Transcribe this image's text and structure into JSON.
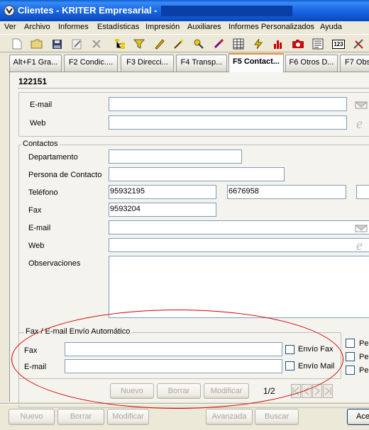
{
  "window": {
    "title": "Clientes - KRITER Empresarial -"
  },
  "menu": [
    "Ver",
    "Archivo",
    "Informes",
    "Estadísticas",
    "Impresión",
    "Auxiliares",
    "Informes Personalizados",
    "Ayuda"
  ],
  "toolbar_icons": [
    "new-icon",
    "open-icon",
    "save-icon",
    "edit-icon",
    "delete-icon",
    "tree-icon",
    "filter-icon",
    "pencil-icon",
    "wand-icon",
    "pin-icon",
    "brush-icon",
    "table-icon",
    "lightning-icon",
    "bar-chart-icon",
    "camera-icon",
    "form-icon",
    "numbers-icon",
    "tools-icon"
  ],
  "toolbar_numbers_label": "123",
  "tabs": [
    {
      "label": "Alt+F1 Gra..."
    },
    {
      "label": "F2 Condic...."
    },
    {
      "label": "F3 Direcci..."
    },
    {
      "label": "F4 Transp..."
    },
    {
      "label": "F5 Contact..."
    },
    {
      "label": "F6 Otros D..."
    },
    {
      "label": "F7 Obs"
    }
  ],
  "record": {
    "code": "122151"
  },
  "top_fields": {
    "email_label": "E-mail",
    "email_value": "",
    "web_label": "Web",
    "web_value": ""
  },
  "contactos": {
    "title": "Contactos",
    "departamento_label": "Departamento",
    "departamento_value": "",
    "persona_label": "Persona de Contacto",
    "persona_value": "",
    "telefono_label": "Teléfono",
    "telefono_1": "95932195",
    "telefono_2": "6676958",
    "telefono_3": "",
    "fax_label": "Fax",
    "fax_value": "9593204",
    "email_label": "E-mail",
    "email_value": "",
    "web_label": "Web",
    "web_value": "",
    "observaciones_label": "Observaciones",
    "observaciones_value": ""
  },
  "auto_send": {
    "title": "Fax / E-mail Envío Automático",
    "fax_label": "Fax",
    "fax_value": "",
    "email_label": "E-mail",
    "email_value": "",
    "envio_fax_label": "Envío Fax",
    "envio_mail_label": "Envío Mail",
    "side_check_1": "Pe",
    "side_check_2": "Pe",
    "side_check_3": "Pe"
  },
  "contact_buttons": {
    "nuevo": "Nuevo",
    "borrar": "Borrar",
    "modificar": "Modificar",
    "page": "1/2"
  },
  "bottom_buttons": {
    "nuevo": "Nuevo",
    "borrar": "Borrar",
    "modificar": "Modificar",
    "avanzada": "Avanzada",
    "buscar": "Buscar",
    "aceptar": "Ace"
  }
}
